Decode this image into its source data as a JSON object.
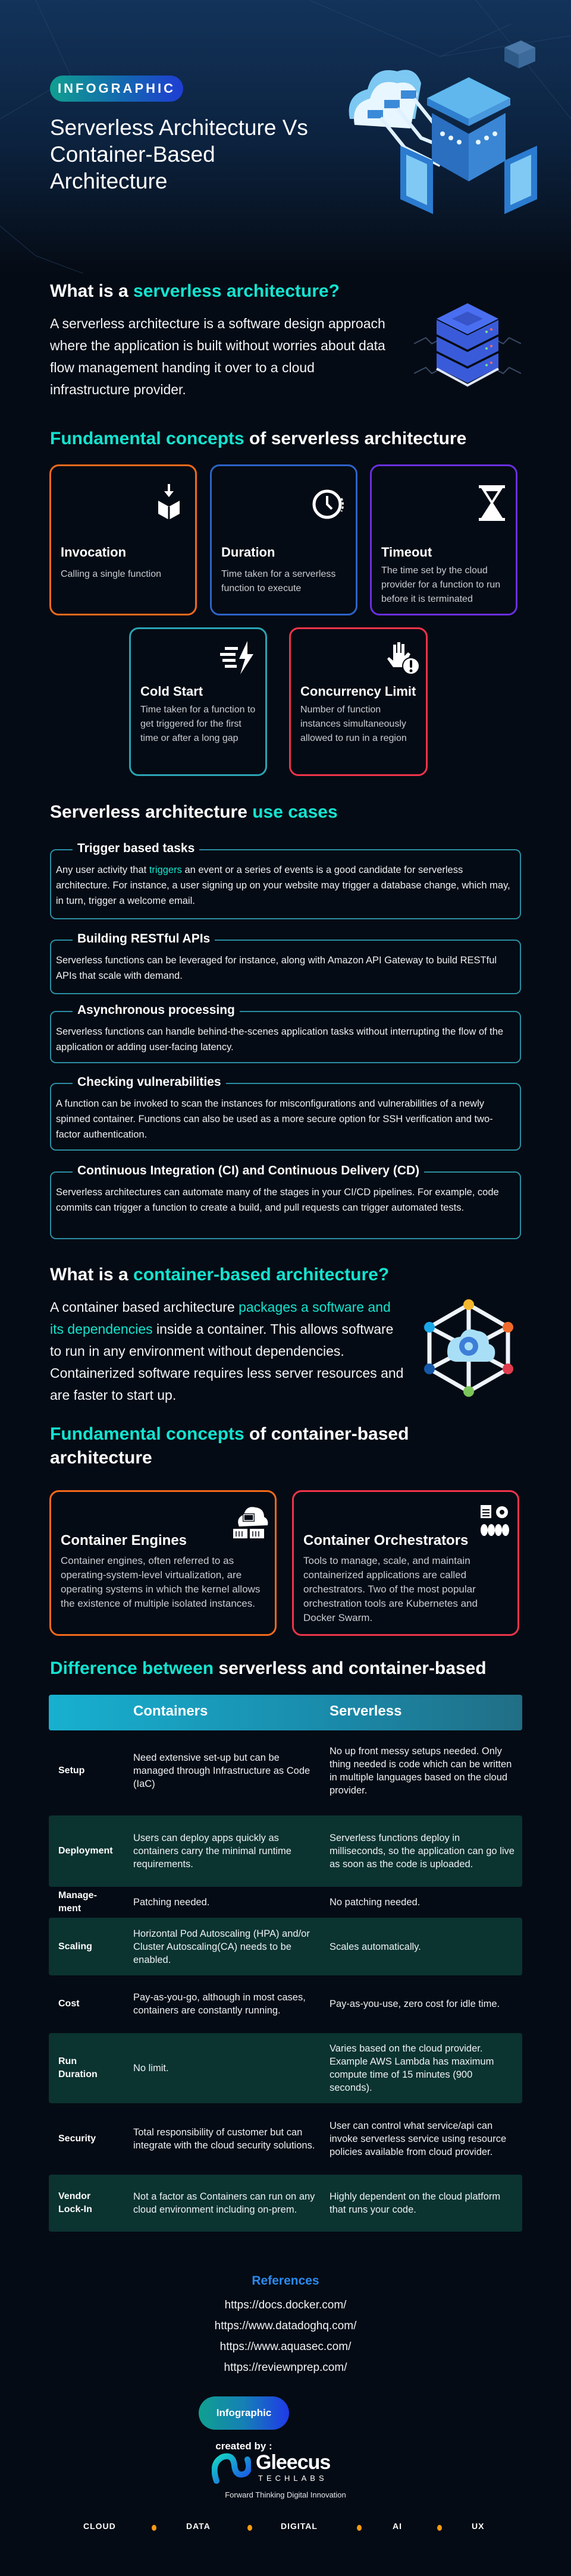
{
  "hero": {
    "badge": "INFOGRAPHIC",
    "title": "Serverless Architecture Vs Container-Based Architecture"
  },
  "serverless_intro": {
    "heading_prefix": "What is a ",
    "heading_accent": "serverless architecture?",
    "text": "A serverless architecture is a software design approach where the application is built without worries about data flow management handing it over to a cloud infrastructure provider.",
    "icon": "server-stack-icon"
  },
  "serverless_concepts": {
    "heading_accent": "Fundamental concepts",
    "heading_rest": " of serverless architecture",
    "cards": [
      {
        "title": "Invocation",
        "desc": "Calling a single function",
        "icon": "invocation-icon",
        "color": "#f26a1b"
      },
      {
        "title": "Duration",
        "desc": "Time taken for a serverless function to execute",
        "icon": "clock-icon",
        "color": "#2d63c8"
      },
      {
        "title": "Timeout",
        "desc": "The time set by the cloud provider for a function to run before it is terminated",
        "icon": "hourglass-icon",
        "color": "#6a2fe0"
      },
      {
        "title": "Cold Start",
        "desc": "Time taken for a function to get triggered for the first time or after a long gap",
        "icon": "lightning-icon",
        "color": "#2aa4b4"
      },
      {
        "title": "Concurrency Limit",
        "desc": "Number of function instances simultaneously allowed to run in a region",
        "icon": "hand-stop-icon",
        "color": "#f0344a"
      }
    ]
  },
  "use_cases": {
    "heading_prefix": "Serverless architecture ",
    "heading_accent": "use cases",
    "items": [
      {
        "label": "Trigger based tasks",
        "text_before": "Any user activity that ",
        "text_accent": "triggers",
        "text_after": " an event or a series of events is a good candidate for serverless architecture. For instance, a user signing up on your website may trigger a database change, which may, in turn, trigger a welcome email."
      },
      {
        "label": "Building RESTful APIs",
        "text_before": "Serverless functions can be leveraged for instance, along with Amazon API Gateway to build  RESTful APIs that scale with demand.",
        "text_accent": "",
        "text_after": ""
      },
      {
        "label": "Asynchronous processing",
        "text_before": "Serverless functions can handle behind-the-scenes application tasks without interrupting the flow of the application or adding user-facing latency.",
        "text_accent": "",
        "text_after": ""
      },
      {
        "label": "Checking vulnerabilities",
        "text_before": "A function can be invoked to scan the instances for misconfigurations and vulnerabilities of a newly spinned container. Functions can also be used as a more secure option for SSH verification and two-factor authentication.",
        "text_accent": "",
        "text_after": ""
      },
      {
        "label": "Continuous Integration (CI) and Continuous Delivery (CD)",
        "text_before": "Serverless architectures can automate many of the stages in your CI/CD pipelines. For example, code commits can trigger a function to create a build, and pull requests can trigger automated tests.",
        "text_accent": "",
        "text_after": ""
      }
    ]
  },
  "container_intro": {
    "heading_prefix": "What is a ",
    "heading_accent": "container-based architecture?",
    "text_before": "A container based architecture ",
    "text_accent": "packages a software and its dependencies",
    "text_after": " inside a container. This allows software to run in any environment without dependencies. Containerized software requires less server resources and are faster to start up.",
    "icon": "container-network-icon"
  },
  "container_concepts": {
    "heading_accent": "Fundamental concepts",
    "heading_rest": " of container-based architecture",
    "cards": [
      {
        "title": "Container Engines",
        "desc": "Container engines, often referred to as operating-system-level virtualization, are operating systems in which the kernel allows the existence of multiple isolated instances.",
        "icon": "cloud-code-containers-icon",
        "color": "#f26a1b"
      },
      {
        "title": "Container Orchestrators",
        "desc": "Tools to manage, scale, and maintain containerized applications are called orchestrators. Two of the most popular orchestration tools are Kubernetes and Docker Swarm.",
        "icon": "document-gear-icon",
        "color": "#f0344a"
      }
    ]
  },
  "difference": {
    "heading_accent": "Difference between",
    "heading_rest": " serverless and container-based",
    "columns": [
      "",
      "Containers",
      "Serverless"
    ],
    "rows": [
      {
        "aspect": "Setup",
        "containers": "Need extensive set-up but can be managed through Infrastructure as Code (IaC)",
        "serverless": "No up front messy setups needed. Only thing needed is code which can be written in multiple languages based on the cloud provider."
      },
      {
        "aspect": "Deployment",
        "containers": "Users can deploy apps quickly as containers carry the minimal runtime requirements.",
        "serverless": "Serverless functions deploy in milliseconds, so the application can go live as soon as the code is uploaded."
      },
      {
        "aspect": "Manage-ment",
        "containers": "Patching needed.",
        "serverless": "No patching needed."
      },
      {
        "aspect": "Scaling",
        "containers": "Horizontal Pod Autoscaling (HPA) and/or Cluster Autoscaling(CA) needs to be enabled.",
        "serverless": "Scales automatically."
      },
      {
        "aspect": "Cost",
        "containers": "Pay-as-you-go, although in most cases, containers are constantly running.",
        "serverless": "Pay-as-you-use, zero cost for idle time."
      },
      {
        "aspect": "Run Duration",
        "containers": "No limit.",
        "serverless": "Varies based on the cloud provider. Example AWS Lambda has maximum compute time of 15 minutes (900 seconds)."
      },
      {
        "aspect": "Security",
        "containers": "Total responsibility of customer but can integrate with the cloud security solutions.",
        "serverless": "User can control what service/api can invoke serverless service using resource policies available from cloud provider."
      },
      {
        "aspect": "Vendor Lock-In",
        "containers": "Not a factor as Containers can run on any cloud environment including on-prem.",
        "serverless": "Highly dependent on the cloud platform that runs your code."
      }
    ]
  },
  "references": {
    "title": "References",
    "links": [
      "https://docs.docker.com/",
      "https://www.datadoghq.com/",
      "https://www.aquasec.com/",
      "https://reviewnprep.com/"
    ]
  },
  "footer": {
    "created_by": "Infographic created by :",
    "brand_name": "Gleecus",
    "brand_sub": "TECHLABS",
    "tagline": "Forward Thinking Digital Innovation",
    "nav": [
      "CLOUD",
      "DATA",
      "DIGITAL",
      "AI",
      "UX"
    ]
  },
  "colors": {
    "background": "#050b14",
    "accent": "#14e3d0",
    "reference_title": "#2b8af0",
    "table_header": "#18b0d0",
    "table_alt_row": "#0b3330",
    "bullet": "#f59a12"
  }
}
